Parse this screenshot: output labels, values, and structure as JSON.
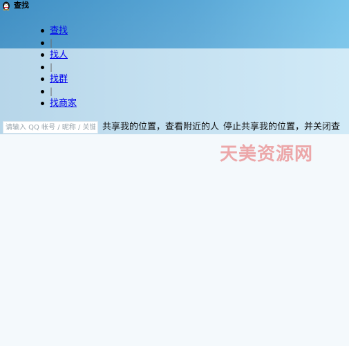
{
  "window": {
    "title": "查找",
    "icon": "qq-penguin-icon"
  },
  "nav": {
    "items": [
      {
        "type": "link",
        "label": "查找"
      },
      {
        "type": "separator",
        "label": "|"
      },
      {
        "type": "link",
        "label": "找人"
      },
      {
        "type": "separator",
        "label": "|"
      },
      {
        "type": "link",
        "label": "找群"
      },
      {
        "type": "separator",
        "label": "|"
      },
      {
        "type": "link",
        "label": "找商家"
      }
    ]
  },
  "search": {
    "placeholder": "请输入 QQ 帐号 / 昵称 / 关键词",
    "value": ""
  },
  "location": {
    "share_text": "共享我的位置，查看附近的人",
    "stop_text": "停止共享我的位置，并关闭查"
  },
  "watermark": {
    "text": "天美资源网"
  },
  "colors": {
    "header_gradient_start": "#3f8fc4",
    "header_gradient_end": "#78c4ea",
    "band_gradient_start": "#b7d6e9",
    "band_gradient_end": "#d1eaf7",
    "link": "#0000ee",
    "watermark": "#e66464",
    "background": "#f4f9fc"
  }
}
